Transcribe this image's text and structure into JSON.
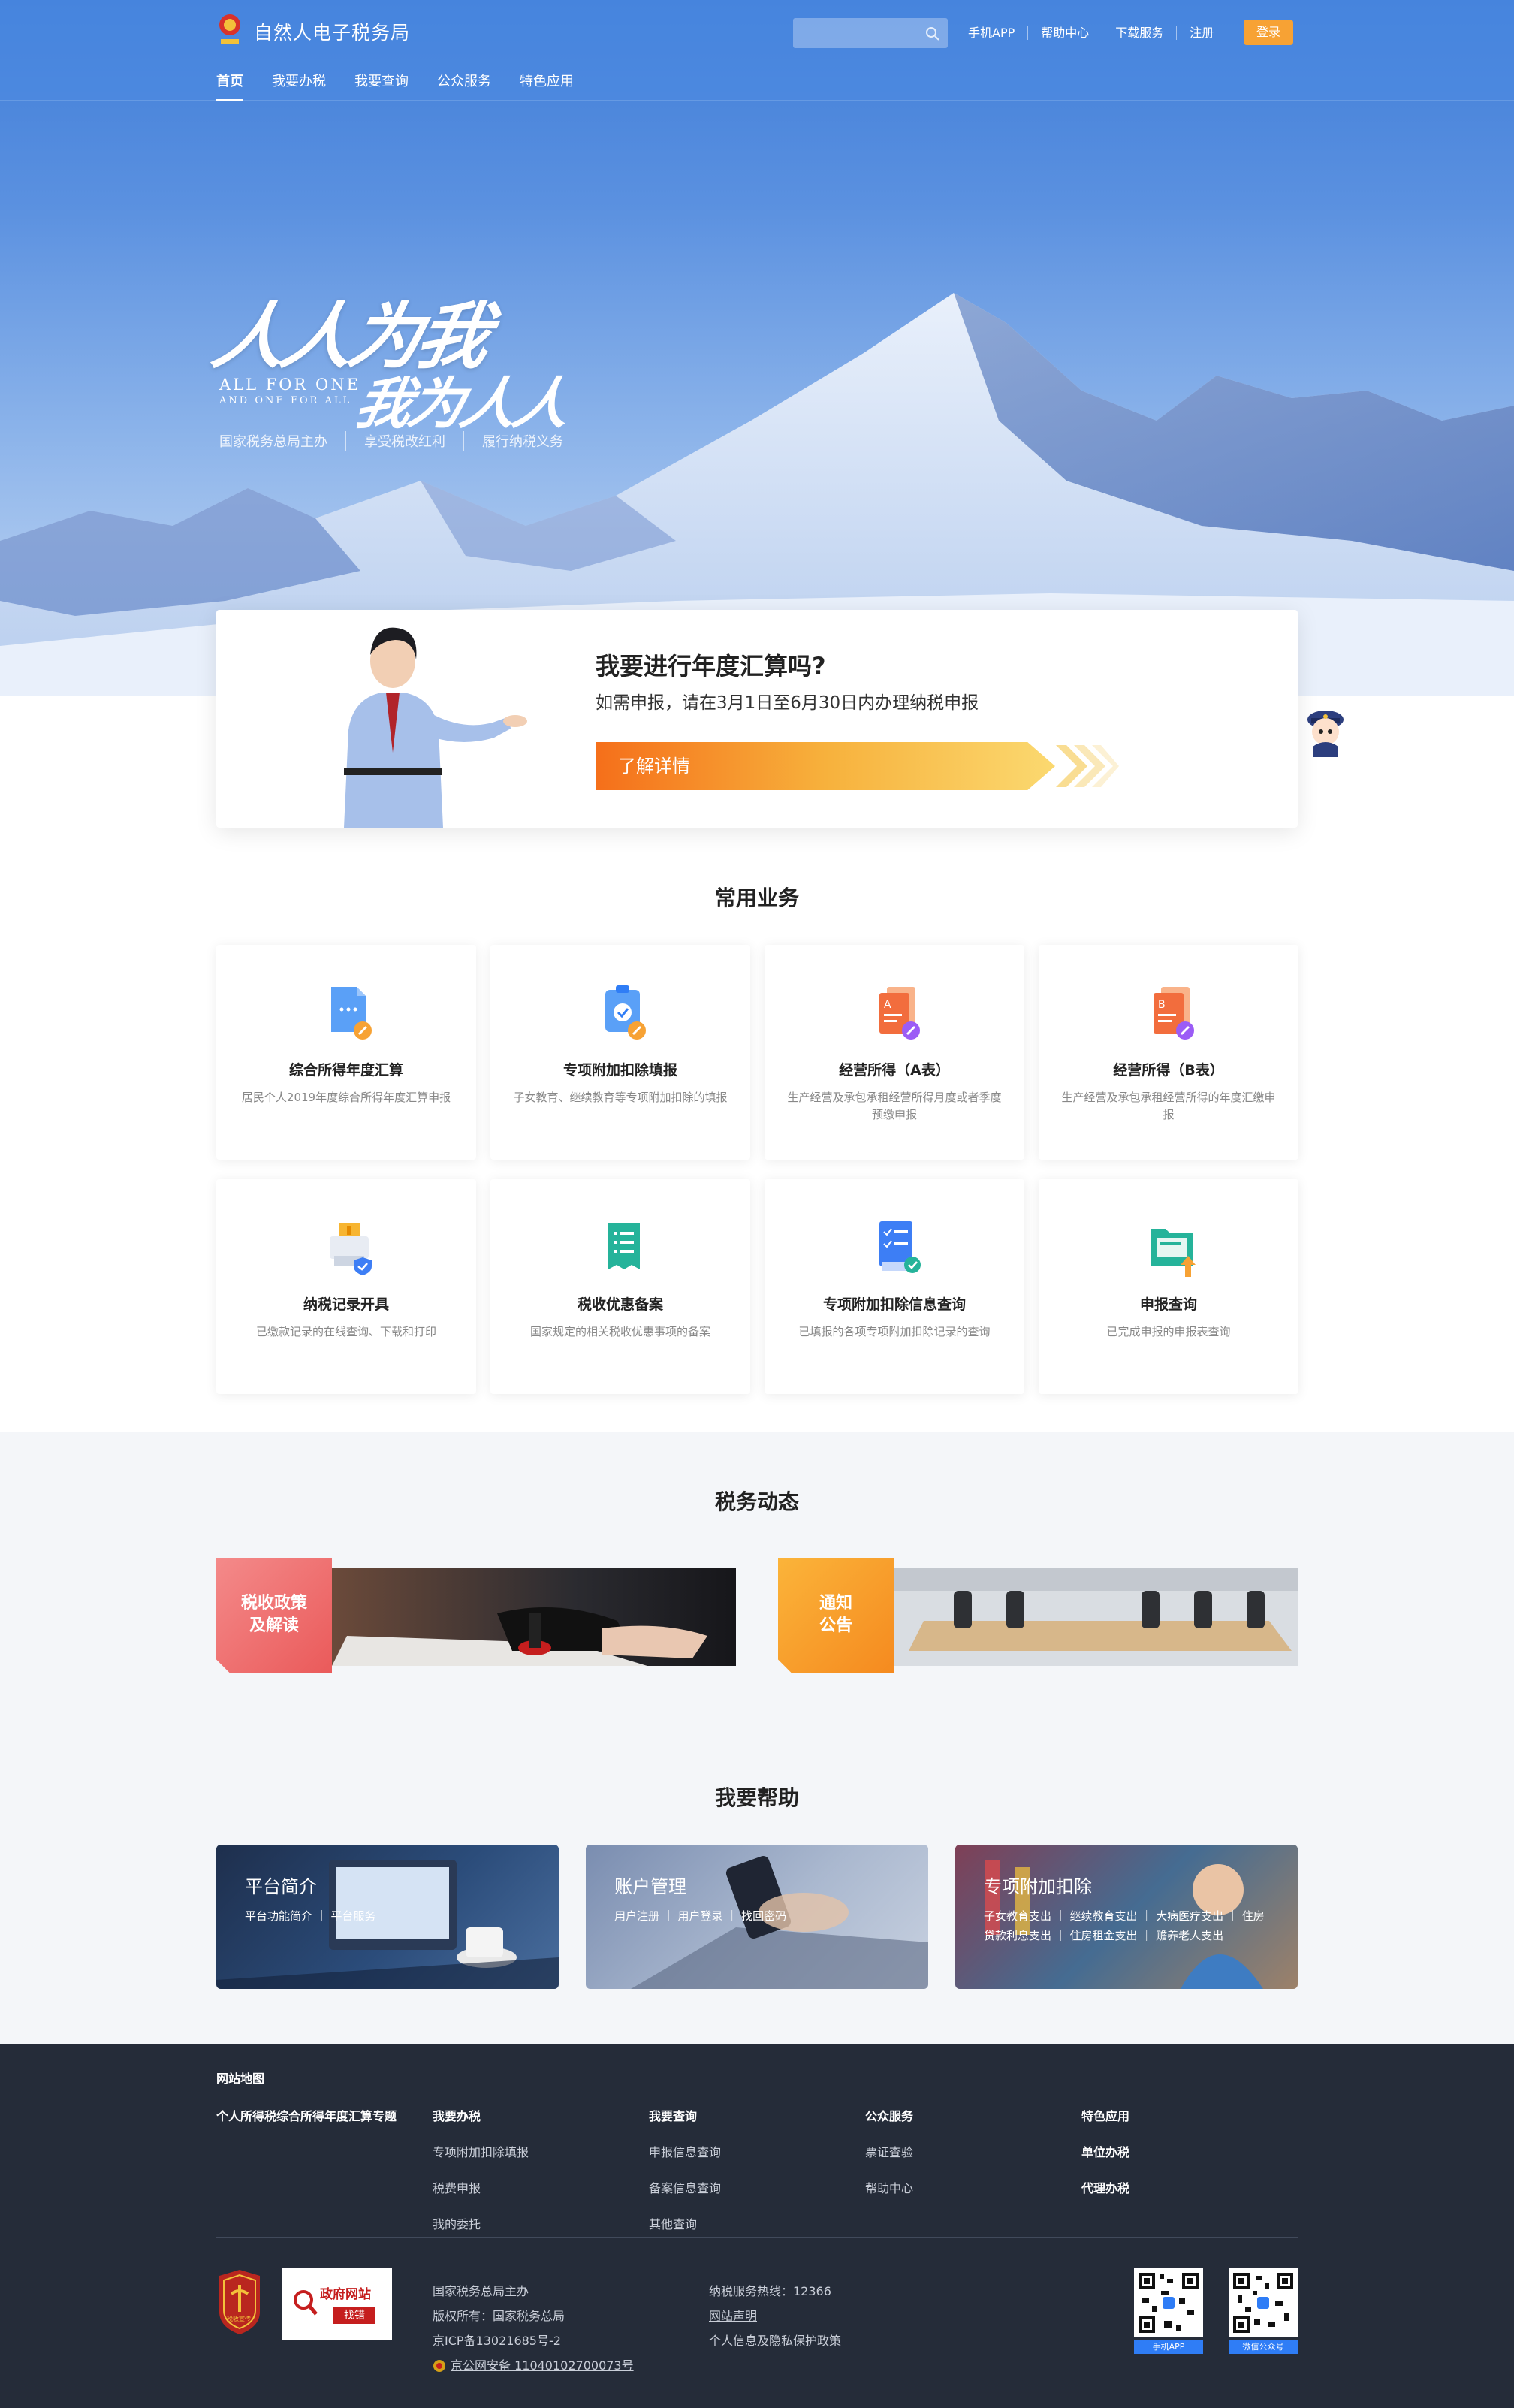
{
  "header": {
    "site_title": "自然人电子税务局",
    "search_placeholder": "",
    "links": [
      "手机APP",
      "帮助中心",
      "下载服务",
      "注册"
    ],
    "login": "登录",
    "nav": [
      "首页",
      "我要办税",
      "我要查询",
      "公众服务",
      "特色应用"
    ]
  },
  "hero": {
    "slogan_top": "人人为我",
    "slogan_bottom": "我为人人",
    "slogan_en_1": "ALL FOR ONE",
    "slogan_en_2": "AND ONE FOR ALL",
    "sub": [
      "国家税务总局主办",
      "享受税改红利",
      "履行纳税义务"
    ]
  },
  "banner": {
    "title": "我要进行年度汇算吗?",
    "subtitle": "如需申报，请在3月1日至6月30日内办理纳税申报",
    "button": "了解详情"
  },
  "services": {
    "title": "常用业务",
    "cards": [
      {
        "title": "综合所得年度汇算",
        "desc": "居民个人2019年度综合所得年度汇算申报",
        "icon": "document-edit-icon"
      },
      {
        "title": "专项附加扣除填报",
        "desc": "子女教育、继续教育等专项附加扣除的填报",
        "icon": "clipboard-check-icon"
      },
      {
        "title": "经营所得（A表）",
        "desc": "生产经营及承包承租经营所得月度或者季度预缴申报",
        "icon": "form-a-icon"
      },
      {
        "title": "经营所得（B表）",
        "desc": "生产经营及承包承租经营所得的年度汇缴申报",
        "icon": "form-b-icon"
      },
      {
        "title": "纳税记录开具",
        "desc": "已缴款记录的在线查询、下载和打印",
        "icon": "printer-shield-icon"
      },
      {
        "title": "税收优惠备案",
        "desc": "国家规定的相关税收优惠事项的备案",
        "icon": "list-document-icon"
      },
      {
        "title": "专项附加扣除信息查询",
        "desc": "已填报的各项专项附加扣除记录的查询",
        "icon": "checklist-query-icon"
      },
      {
        "title": "申报查询",
        "desc": "已完成申报的申报表查询",
        "icon": "folder-upload-icon"
      }
    ]
  },
  "news": {
    "title": "税务动态",
    "items": [
      {
        "label_1": "税收政策",
        "label_2": "及解读",
        "color": "#ef6f6f"
      },
      {
        "label_1": "通知",
        "label_2": "公告",
        "color": "#f7992d"
      }
    ]
  },
  "help": {
    "title": "我要帮助",
    "cards": [
      {
        "title": "平台简介",
        "links": "平台功能简介 ｜ 平台服务"
      },
      {
        "title": "账户管理",
        "links": "用户注册 ｜ 用户登录 ｜ 找回密码"
      },
      {
        "title": "专项附加扣除",
        "links": "子女教育支出 ｜ 继续教育支出 ｜ 大病医疗支出 ｜ 住房贷款利息支出 ｜ 住房租金支出 ｜ 赡养老人支出"
      }
    ]
  },
  "footer": {
    "sitemap": "网站地图",
    "col0": {
      "title": "个人所得税综合所得年度汇算专题"
    },
    "col1": {
      "title": "我要办税",
      "items": [
        "专项附加扣除填报",
        "税费申报",
        "我的委托"
      ]
    },
    "col2": {
      "title": "我要查询",
      "items": [
        "申报信息查询",
        "备案信息查询",
        "其他查询"
      ]
    },
    "col3": {
      "title": "公众服务",
      "items": [
        "票证查验",
        "帮助中心"
      ]
    },
    "col4": {
      "title": "特色应用",
      "items": [
        "单位办税",
        "代理办税"
      ]
    },
    "govbox_1": "政府网站",
    "govbox_2": "找错",
    "emblem_text": "税收宣传",
    "info": [
      "国家税务总局主办",
      "版权所有：国家税务总局",
      "京ICP备13021685号-2",
      "京公网安备 11040102700073号"
    ],
    "hotline": "纳税服务热线：12366",
    "statement": "网站声明",
    "privacy": "个人信息及隐私保护政策",
    "qr1": "手机APP",
    "qr2": "微信公众号"
  }
}
